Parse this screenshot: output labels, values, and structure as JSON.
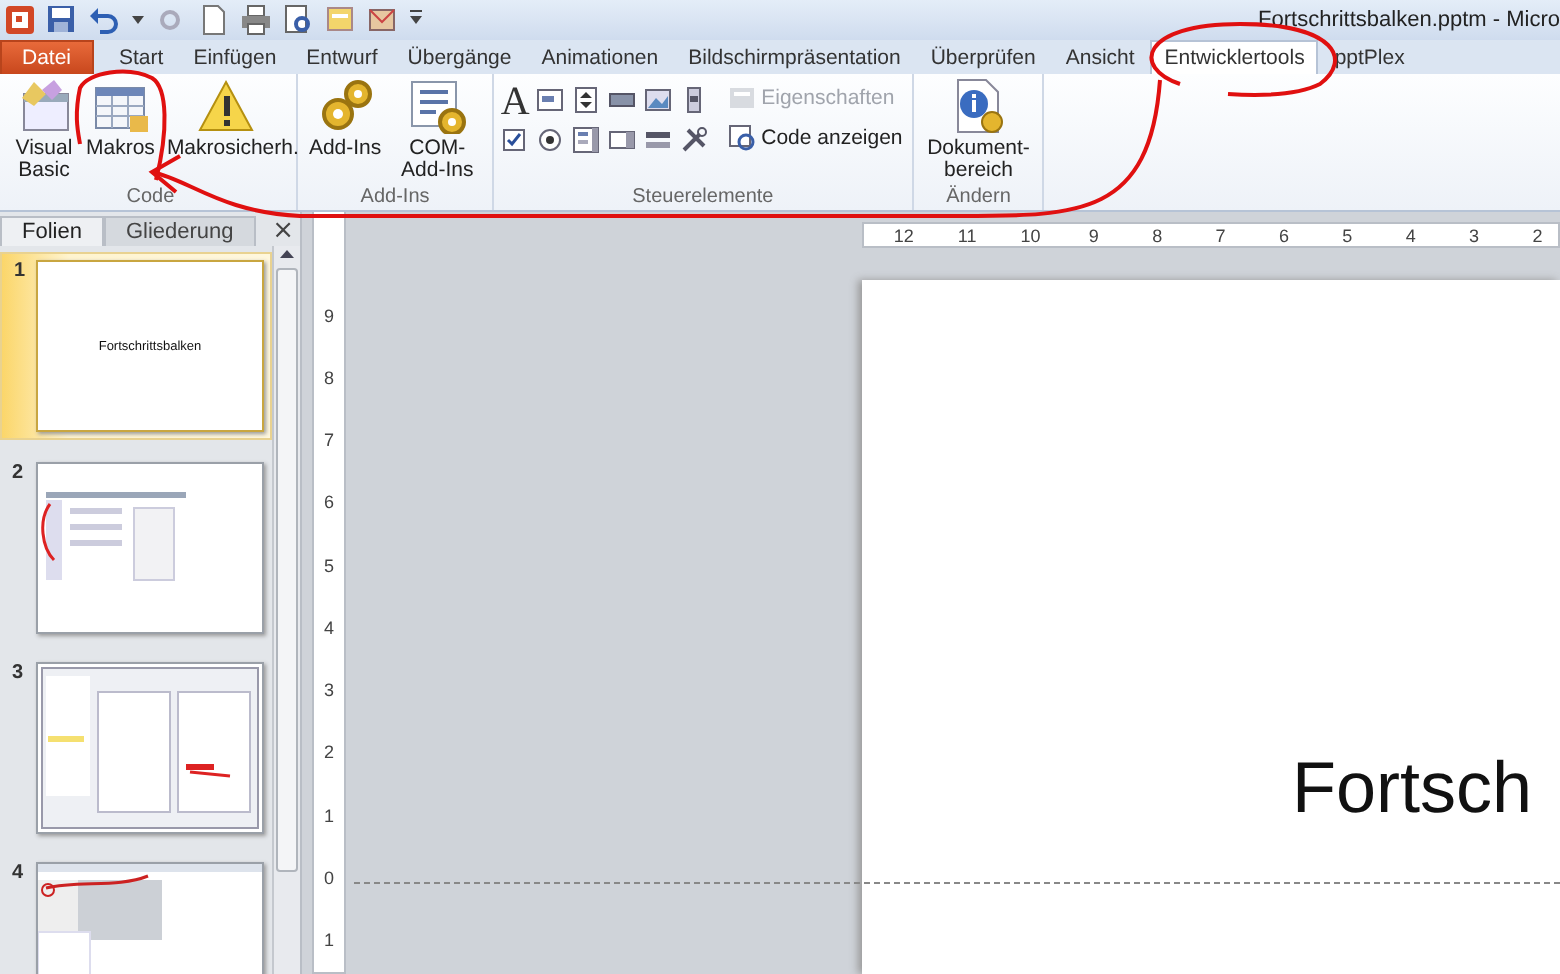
{
  "window": {
    "title": "Fortschrittsbalken.pptm - Micro"
  },
  "ribbon_tabs": [
    {
      "label": "Datei",
      "kind": "file",
      "selected": false
    },
    {
      "label": "Start",
      "kind": "tab",
      "selected": false
    },
    {
      "label": "Einfügen",
      "kind": "tab",
      "selected": false
    },
    {
      "label": "Entwurf",
      "kind": "tab",
      "selected": false
    },
    {
      "label": "Übergänge",
      "kind": "tab",
      "selected": false
    },
    {
      "label": "Animationen",
      "kind": "tab",
      "selected": false
    },
    {
      "label": "Bildschirmpräsentation",
      "kind": "tab",
      "selected": false
    },
    {
      "label": "Überprüfen",
      "kind": "tab",
      "selected": false
    },
    {
      "label": "Ansicht",
      "kind": "tab",
      "selected": false
    },
    {
      "label": "Entwicklertools",
      "kind": "tab",
      "selected": true
    },
    {
      "label": "pptPlex",
      "kind": "tab",
      "selected": false
    }
  ],
  "ribbon_groups": [
    {
      "label": "Code",
      "items": [
        {
          "kind": "large",
          "label": "Visual Basic"
        },
        {
          "kind": "large",
          "label": "Makros"
        },
        {
          "kind": "large",
          "label": "Makrosicherh."
        }
      ]
    },
    {
      "label": "Add-Ins",
      "items": [
        {
          "kind": "large",
          "label": "Add-Ins"
        },
        {
          "kind": "large",
          "label": "COM-Add-Ins"
        }
      ]
    },
    {
      "label": "Steuerelemente",
      "items": [
        {
          "kind": "gallery",
          "glyph": "A"
        },
        {
          "kind": "small",
          "label": "Eigenschaften",
          "disabled": true
        },
        {
          "kind": "small",
          "label": "Code anzeigen",
          "disabled": false
        }
      ]
    },
    {
      "label": "Ändern",
      "items": [
        {
          "kind": "large",
          "label": "Dokument-bereich"
        }
      ]
    }
  ],
  "slide_pane": {
    "tabs": [
      {
        "label": "Folien",
        "selected": true
      },
      {
        "label": "Gliederung",
        "selected": false
      }
    ],
    "close": "×",
    "slides": [
      {
        "number": "1",
        "selected": true,
        "title": "Fortschrittsbalken"
      },
      {
        "number": "2",
        "selected": false
      },
      {
        "number": "3",
        "selected": false
      },
      {
        "number": "4",
        "selected": false
      }
    ]
  },
  "rulers": {
    "horizontal": [
      "12",
      "11",
      "10",
      "9",
      "8",
      "7",
      "6",
      "5",
      "4",
      "3",
      "2"
    ],
    "vertical": [
      "9",
      "8",
      "7",
      "6",
      "5",
      "4",
      "3",
      "2",
      "1",
      "0",
      "1"
    ]
  },
  "slide": {
    "title": "Fortsch"
  }
}
